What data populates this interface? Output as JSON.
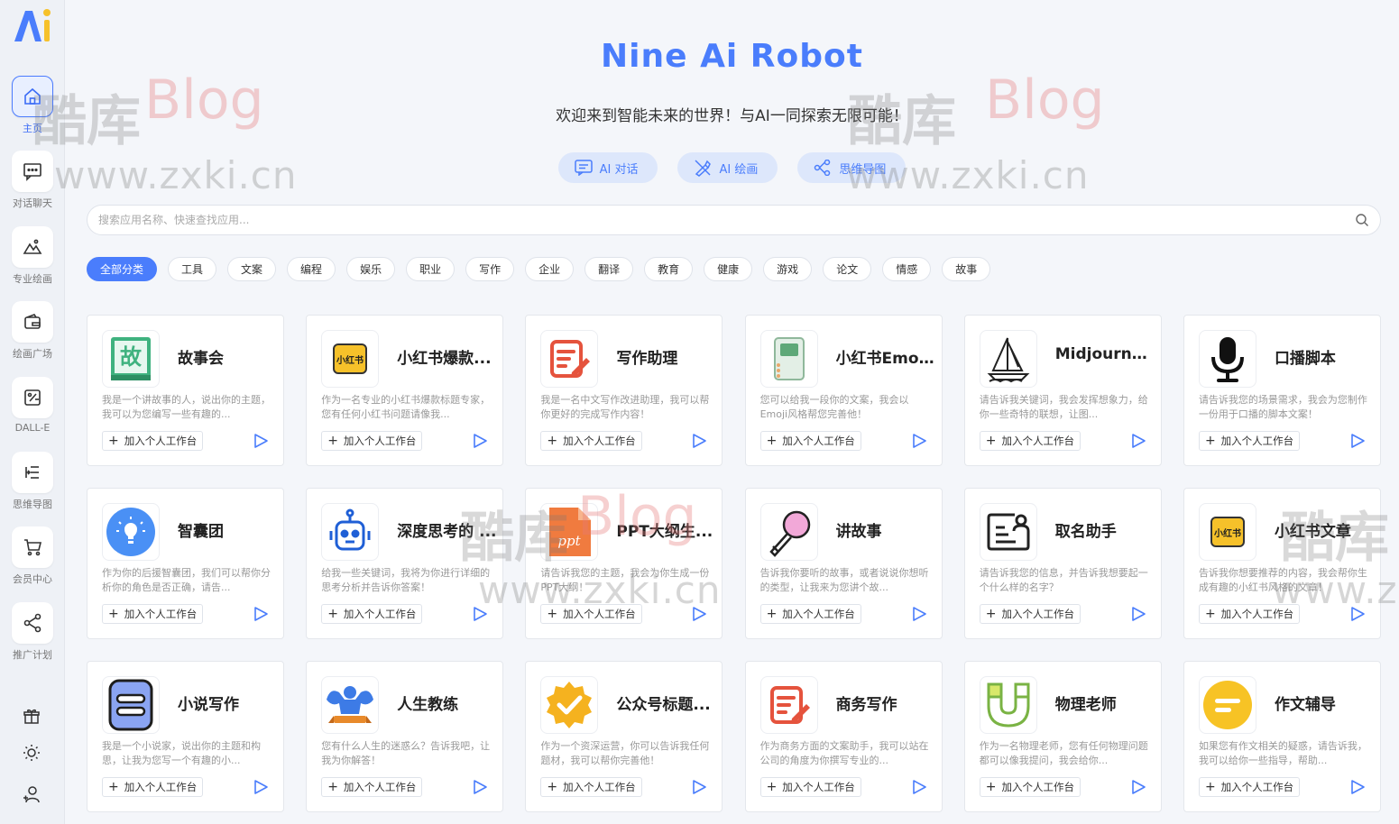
{
  "sidebar": {
    "logo_text": "Ai",
    "items": [
      {
        "label": "主页",
        "icon": "home-icon",
        "active": true
      },
      {
        "label": "对话聊天",
        "icon": "chat-icon"
      },
      {
        "label": "专业绘画",
        "icon": "mountain-icon"
      },
      {
        "label": "绘画广场",
        "icon": "wallet-icon"
      },
      {
        "label": "DALL-E",
        "icon": "brush-icon"
      },
      {
        "label": "思维导图",
        "icon": "mindmap-icon"
      },
      {
        "label": "会员中心",
        "icon": "cart-icon"
      },
      {
        "label": "推广计划",
        "icon": "share-icon"
      }
    ],
    "bottom_icons": [
      "gift-icon",
      "sun-icon",
      "user-add-icon"
    ]
  },
  "header": {
    "title": "Nine Ai Robot",
    "subtitle": "欢迎来到智能未来的世界！与AI一同探索无限可能！",
    "modes": [
      {
        "label": "AI 对话",
        "icon": "chat-icon"
      },
      {
        "label": "AI 绘画",
        "icon": "paint-icon"
      },
      {
        "label": "思维导图",
        "icon": "mindmap-icon"
      }
    ]
  },
  "search": {
    "placeholder": "搜索应用名称、快速查找应用..."
  },
  "categories": [
    "全部分类",
    "工具",
    "文案",
    "编程",
    "娱乐",
    "职业",
    "写作",
    "企业",
    "翻译",
    "教育",
    "健康",
    "游戏",
    "论文",
    "情感",
    "故事"
  ],
  "add_label": "加入个人工作台",
  "cards": [
    {
      "title": "故事会",
      "desc": "我是一个讲故事的人，说出你的主题，我可以为您编写一些有趣的...",
      "icon": "story-book-icon"
    },
    {
      "title": "小红书爆款...",
      "desc": "作为一名专业的小红书爆款标题专家，您有任何小红书问题请像我...",
      "icon": "xiaohongshu-icon"
    },
    {
      "title": "写作助理",
      "desc": "我是一名中文写作改进助理，我可以帮你更好的完成写作内容！",
      "icon": "writing-icon"
    },
    {
      "title": "小红书Emoj...",
      "desc": "您可以给我一段你的文案，我会以Emoji风格帮您完善他！",
      "icon": "notebook-icon"
    },
    {
      "title": "Midjourney...",
      "desc": "请告诉我关键词，我会发挥想象力，给你一些奇特的联想，让图...",
      "icon": "sailboat-icon"
    },
    {
      "title": "口播脚本",
      "desc": "请告诉我您的场景需求，我会为您制作一份用于口播的脚本文案！",
      "icon": "microphone-icon"
    },
    {
      "title": "智囊团",
      "desc": "作为你的后援智囊团，我们可以帮你分析你的角色是否正确，请告...",
      "icon": "lightbulb-icon"
    },
    {
      "title": "深度思考的 ...",
      "desc": "给我一些关键词，我将为你进行详细的思考分析并告诉你答案！",
      "icon": "robot-icon"
    },
    {
      "title": "PPT大纲生...",
      "desc": "请告诉我您的主题，我会为你生成一份PPT大纲！",
      "icon": "ppt-icon"
    },
    {
      "title": "讲故事",
      "desc": "告诉我你要听的故事，或者说说你想听的类型，让我来为您讲个故...",
      "icon": "karaoke-mic-icon"
    },
    {
      "title": "取名助手",
      "desc": "请告诉我您的信息，并告诉我想要起一个什么样的名字？",
      "icon": "id-card-icon"
    },
    {
      "title": "小红书文章",
      "desc": "告诉我你想要推荐的内容，我会帮你生成有趣的小红书风格的文章！",
      "icon": "xiaohongshu-icon"
    },
    {
      "title": "小说写作",
      "desc": "我是一个小说家，说出你的主题和构思，让我为您写一个有趣的小...",
      "icon": "document-icon"
    },
    {
      "title": "人生教练",
      "desc": "您有什么人生的迷惑么？告诉我吧，让我为你解答！",
      "icon": "muscle-icon"
    },
    {
      "title": "公众号标题...",
      "desc": "作为一个资深运营，你可以告诉我任何题材，我可以帮你完善他！",
      "icon": "badge-check-icon"
    },
    {
      "title": "商务写作",
      "desc": "作为商务方面的文案助手，我可以站在公司的角度为你撰写专业的...",
      "icon": "writing-icon"
    },
    {
      "title": "物理老师",
      "desc": "作为一名物理老师，您有任何物理问题都可以像我提问，我会给你...",
      "icon": "magnet-icon"
    },
    {
      "title": "作文辅导",
      "desc": "如果您有作文相关的疑惑，请告诉我，我可以给你一些指导，帮助...",
      "icon": "text-circle-icon"
    }
  ],
  "watermark": {
    "cn": "酷库",
    "blog": "Blog",
    "url": "www.zxki.cn"
  },
  "colors": {
    "accent": "#4a7dfc",
    "mode_bg": "#dde7fb",
    "page_bg": "#f4f6fa"
  }
}
